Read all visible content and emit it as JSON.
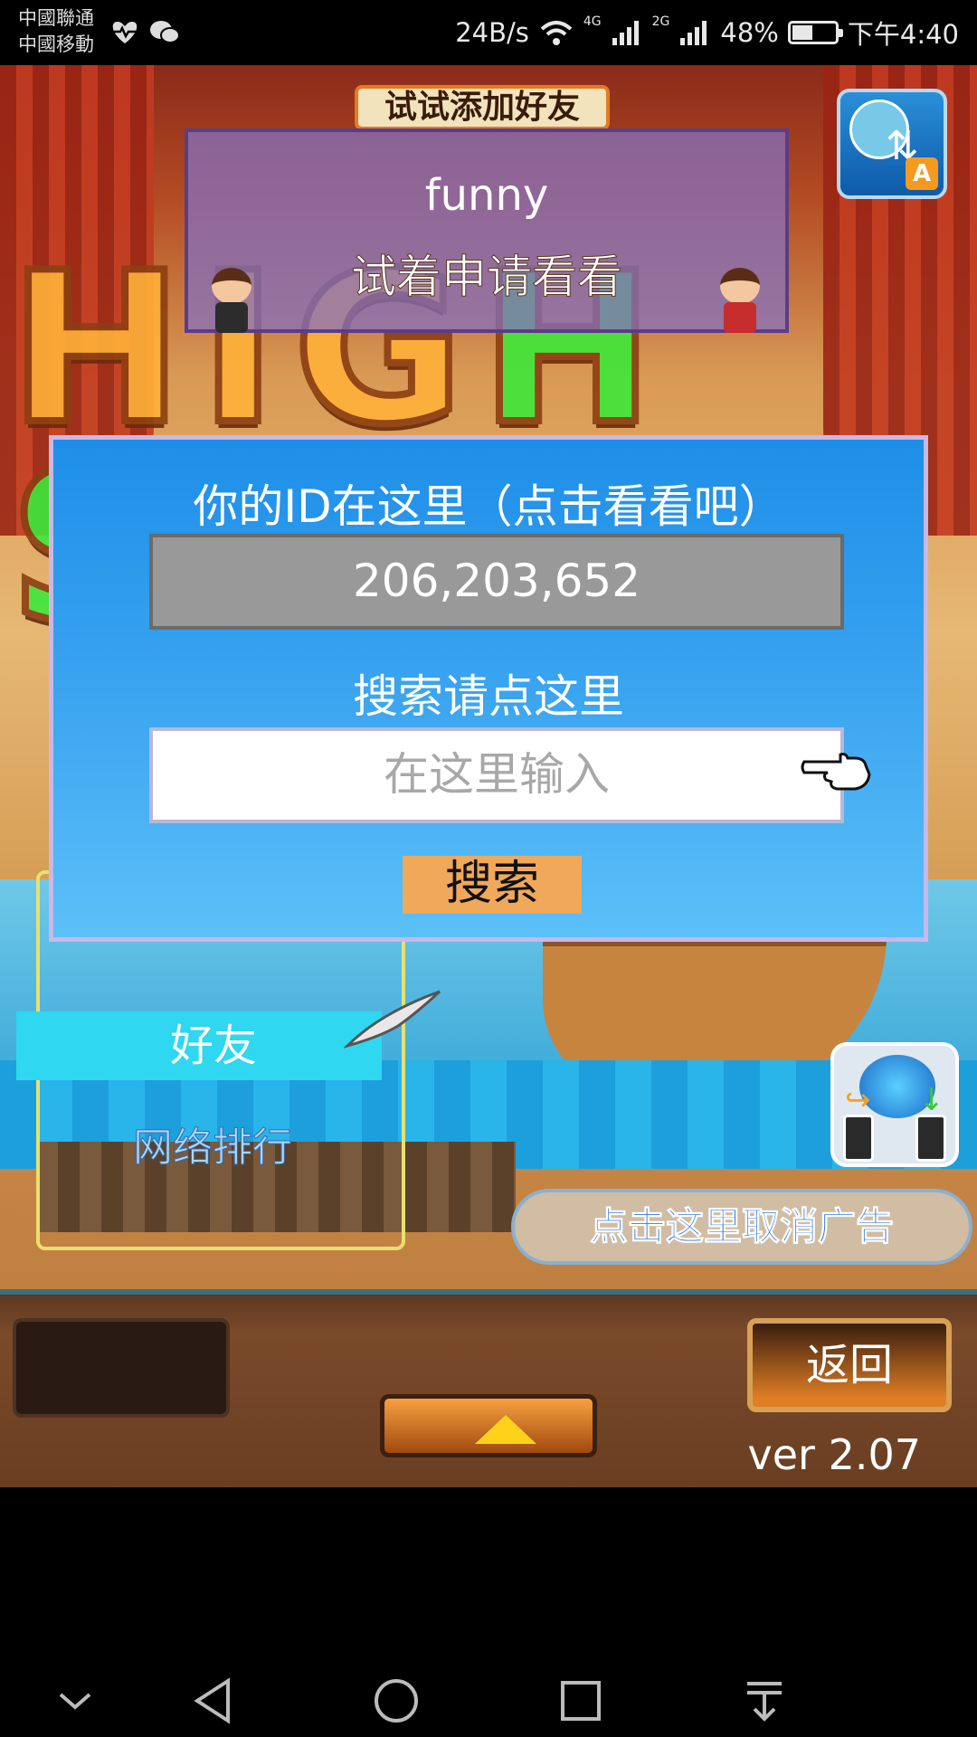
{
  "status_bar": {
    "carrier_1": "中國聯通",
    "carrier_2": "中國移動",
    "speed": "24B/s",
    "net_4g": "4G",
    "net_2g": "2G",
    "battery": "48%",
    "battery_level": 0.48,
    "time": "下午4:40"
  },
  "game": {
    "tip_banner": "试试添加好友",
    "friend_card": {
      "name": "funny",
      "hint": "试着申请看看"
    },
    "logo": "HIGH SEA",
    "id_dialog": {
      "title": "你的ID在这里（点击看看吧）",
      "id_value": "206,203,652",
      "search_title": "搜索请点这里",
      "search_placeholder": "在这里输入",
      "search_button": "搜索"
    },
    "menu": {
      "friends_tab": "好友",
      "ranking_tab": "网络排行"
    },
    "ad_bar": "点击这里取消广告",
    "back_button": "返回",
    "version": "ver 2.07"
  },
  "icons": {
    "heart": "heart-pulse-icon",
    "wechat": "wechat-icon",
    "wifi": "wifi-icon",
    "signal": "signal-icon",
    "swap": "account-swap-icon",
    "network": "network-connect-icon"
  },
  "colors": {
    "dialog_bg": "#3aa4f0",
    "search_button": "#f0a85a",
    "friends_tab": "#2fd7f0"
  }
}
